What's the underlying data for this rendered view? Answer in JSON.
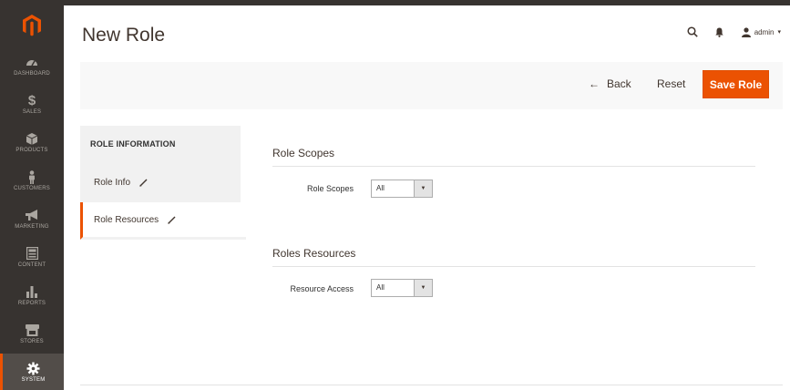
{
  "page": {
    "title": "New Role"
  },
  "header": {
    "user_name": "admin",
    "user_caret": "▾"
  },
  "sidebar": {
    "items": [
      {
        "label": "Dashboard",
        "icon": "dashboard-icon"
      },
      {
        "label": "Sales",
        "icon": "dollar-icon",
        "glyph": "$"
      },
      {
        "label": "Products",
        "icon": "cube-icon"
      },
      {
        "label": "Customers",
        "icon": "person-icon"
      },
      {
        "label": "Marketing",
        "icon": "megaphone-icon"
      },
      {
        "label": "Content",
        "icon": "layout-icon"
      },
      {
        "label": "Reports",
        "icon": "bar-chart-icon"
      },
      {
        "label": "Stores",
        "icon": "store-icon"
      },
      {
        "label": "System",
        "icon": "gear-icon"
      }
    ],
    "active": "System"
  },
  "actions": {
    "back_arrow": "←",
    "back_label": "Back",
    "reset_label": "Reset",
    "save_label": "Save Role",
    "accent": "#eb5202"
  },
  "tabs": {
    "title": "ROLE INFORMATION",
    "items": [
      {
        "label": "Role Info"
      },
      {
        "label": "Role Resources"
      }
    ],
    "active": "Role Resources"
  },
  "form": {
    "scopes_section": "Role Scopes",
    "scopes_label": "Role Scopes",
    "scopes_value": "All",
    "resources_section": "Roles Resources",
    "access_label": "Resource Access",
    "access_value": "All",
    "select_caret": "▼"
  }
}
